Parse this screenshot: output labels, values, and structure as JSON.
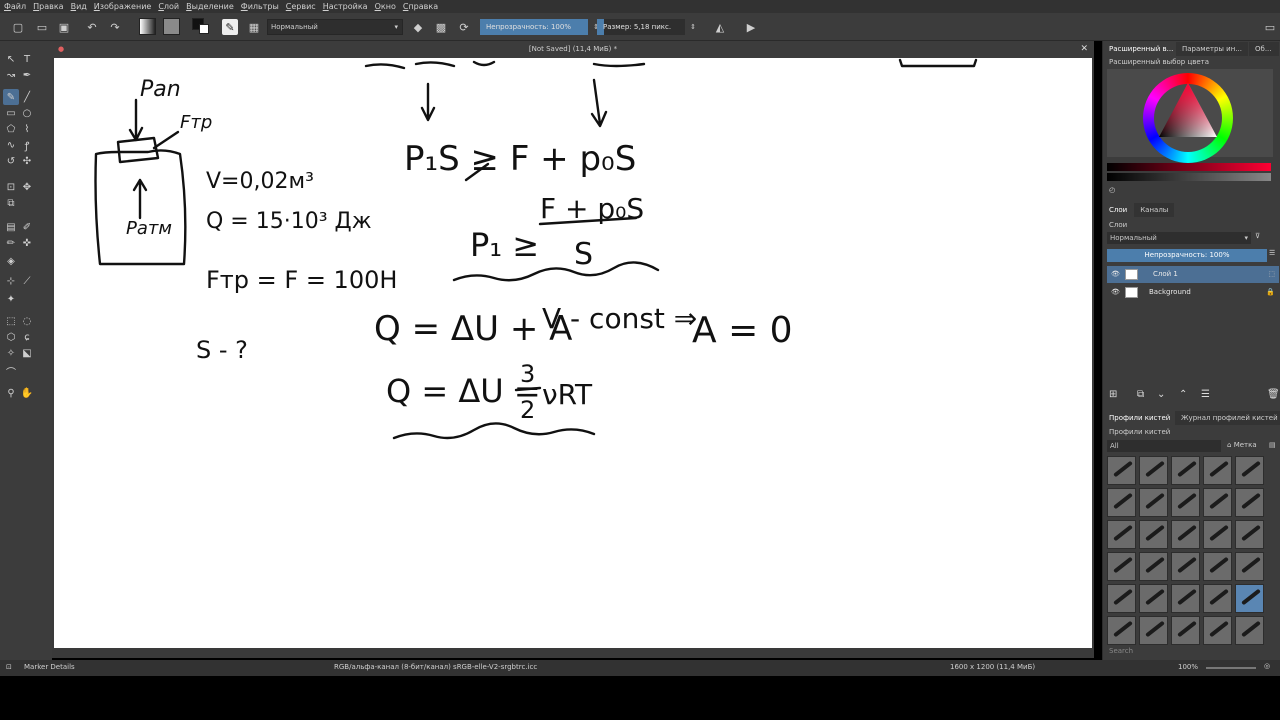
{
  "menu": [
    "Файл",
    "Правка",
    "Вид",
    "Изображение",
    "Слой",
    "Выделение",
    "Фильтры",
    "Сервис",
    "Настройка",
    "Окно",
    "Справка"
  ],
  "toolbar": {
    "blend_mode": "Нормальный",
    "opacity_label": "Непрозрачность: 100%",
    "opacity_value": 100,
    "size_label": "Размер: 5,18 пикс."
  },
  "document": {
    "title": "[Not Saved]  (11,4 МиБ) *"
  },
  "docker": {
    "top_tabs": [
      "Расширенный в...",
      "Параметры ин...",
      "Об..."
    ],
    "color_title": "Расширенный выбор цвета",
    "layers_tabs": [
      "Слои",
      "Каналы"
    ],
    "layers_title": "Слои",
    "layer_blend": "Нормальный",
    "layer_opacity": "Непрозрачность:  100%",
    "layers": [
      {
        "name": "Слой 1",
        "selected": true
      },
      {
        "name": "Background",
        "selected": false
      }
    ],
    "brush_tabs": [
      "Профили кистей",
      "Журнал профилей кистей"
    ],
    "brush_title": "Профили кистей",
    "brush_filter": "All",
    "brush_tag": "Метка",
    "search_placeholder": "Search"
  },
  "status": {
    "tool": "Marker Details",
    "colorspace": "RGB/альфа-канал (8-бит/канал)  sRGB-elle-V2-srgbtrc.icc",
    "dimensions": "1600 x 1200 (11,4 МиБ)",
    "zoom": "100%"
  },
  "canvas_text": {
    "panel": "Pan",
    "ftr": "Fтр",
    "patm": "Pатм",
    "v_eq": "V=0,02м³",
    "q_eq": "Q = 15·10³ Дж",
    "f_eq": "Fтр = F = 100Н",
    "s_q": "S - ?",
    "ineq1": "P₁S ≥ F + p₀S",
    "num": "F + p₀S",
    "p1ge": "P₁ ≥",
    "den": "S",
    "first_law": "Q = ΔU + A",
    "const": "V - const ⇒",
    "a_zero": "A = 0",
    "du": "Q = ΔU = ",
    "frac_num": "3",
    "frac_den": "2",
    "nrt": "νRT"
  },
  "colors": {
    "accent": "#4c7eac",
    "panel_bg": "#3c3c3c",
    "canvas_bg": "#ffffff"
  }
}
